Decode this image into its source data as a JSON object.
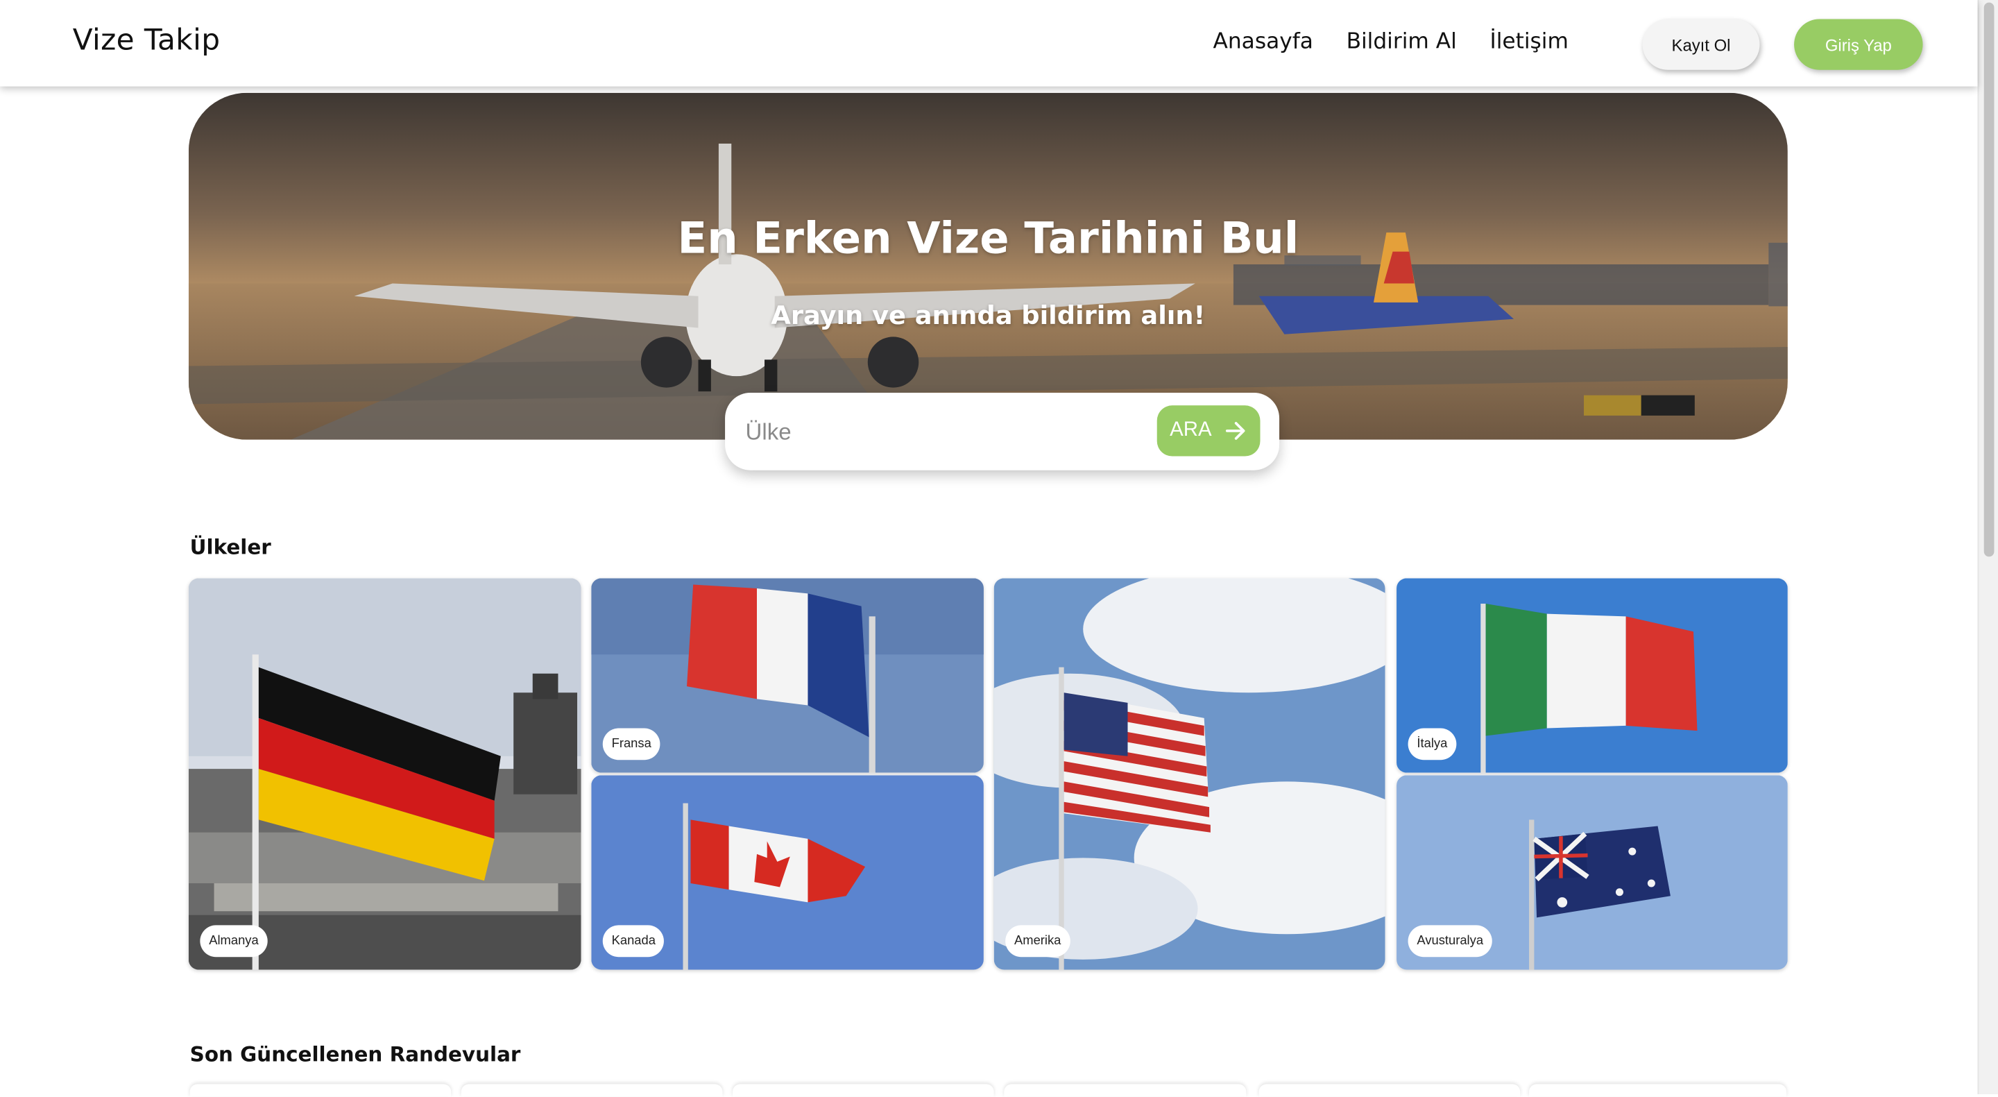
{
  "header": {
    "logo": "Vize Takip",
    "nav": [
      "Anasayfa",
      "Bildirim Al",
      "İletişim"
    ],
    "register_label": "Kayıt Ol",
    "login_label": "Giriş Yap"
  },
  "hero": {
    "title": "En Erken Vize Tarihini Bul",
    "subtitle": "Arayın ve anında bildirim alın!"
  },
  "search": {
    "placeholder": "Ülke",
    "value": "",
    "button_label": "ARA",
    "button_icon": "arrow-right-icon"
  },
  "countries": {
    "title": "Ülkeler",
    "items": [
      {
        "name": "Almanya"
      },
      {
        "name": "Fransa"
      },
      {
        "name": "Kanada"
      },
      {
        "name": "Amerika"
      },
      {
        "name": "İtalya"
      },
      {
        "name": "Avusturalya"
      }
    ]
  },
  "recent": {
    "title": "Son Güncellenen Randevular"
  },
  "colors": {
    "accent": "#98cc64",
    "register_bg": "#f4f4f4"
  }
}
